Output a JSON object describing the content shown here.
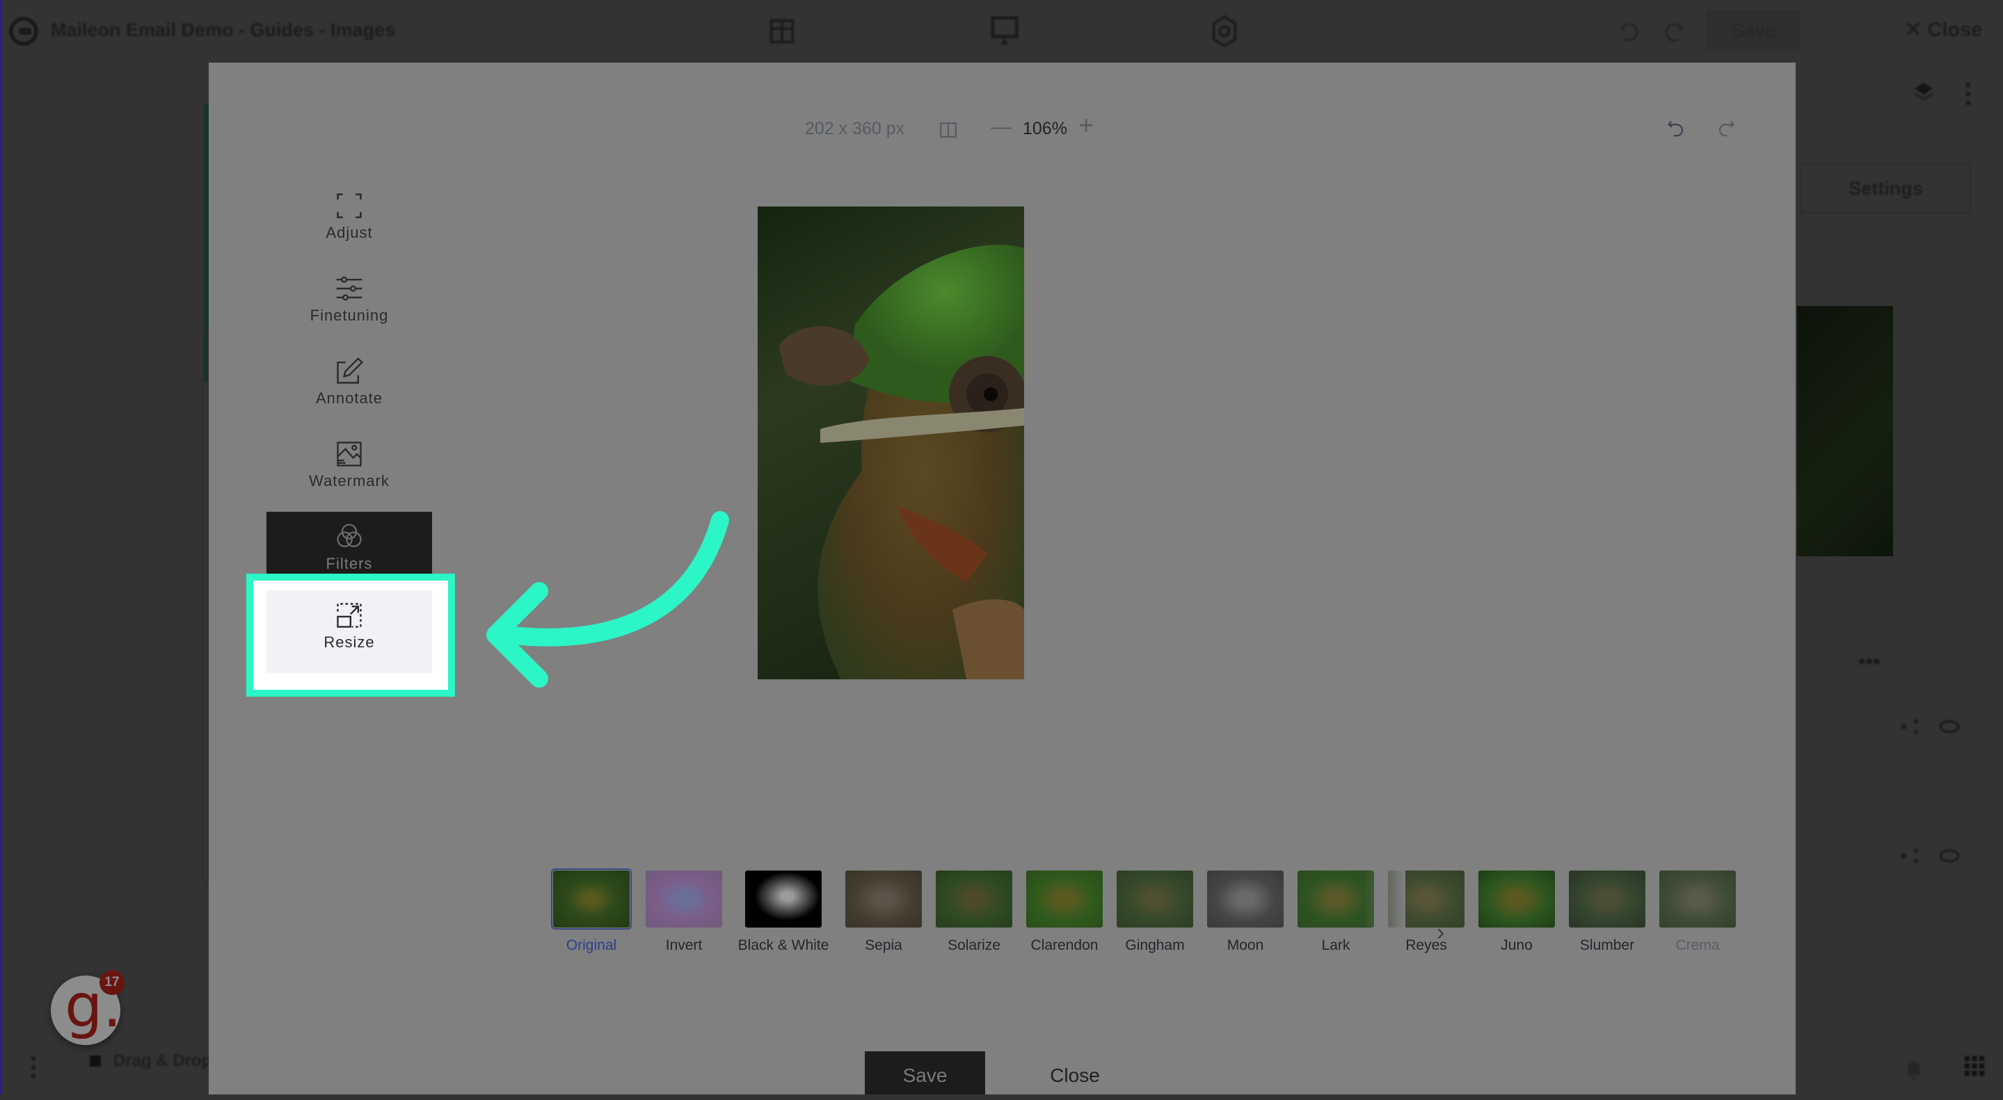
{
  "background_app": {
    "title": "Maileon Email Demo - Guides - Images",
    "save_label": "Save",
    "close_label": "Close",
    "settings_label": "Settings",
    "bottom_item_label": "Drag & Drop",
    "icons": [
      "layout-icon",
      "desktop-preview-icon",
      "settings-gear-icon",
      "undo-icon",
      "redo-icon",
      "layers-icon",
      "more-vert-icon",
      "bell-icon",
      "apps-grid-icon"
    ]
  },
  "gamification_widget": {
    "letter": "g.",
    "badge_count": "17",
    "brand_color": "#6a1410"
  },
  "editor": {
    "image_dimensions": "202 x 360 px",
    "zoom_level": "106%",
    "zoom_out_label": "—",
    "zoom_in_label": "+",
    "side_menu": [
      {
        "id": "adjust",
        "label": "Adjust",
        "icon": "crop-corners-icon",
        "state": "normal"
      },
      {
        "id": "finetuning",
        "label": "Finetuning",
        "icon": "sliders-icon",
        "state": "normal"
      },
      {
        "id": "annotate",
        "label": "Annotate",
        "icon": "pencil-edit-icon",
        "state": "normal"
      },
      {
        "id": "watermark",
        "label": "Watermark",
        "icon": "image-watermark-icon",
        "state": "normal"
      },
      {
        "id": "filters",
        "label": "Filters",
        "icon": "color-circles-icon",
        "state": "active"
      },
      {
        "id": "resize",
        "label": "Resize",
        "icon": "resize-arrow-icon",
        "state": "highlighted"
      }
    ],
    "filters": [
      {
        "label": "Original",
        "selected": true
      },
      {
        "label": "Invert",
        "selected": false
      },
      {
        "label": "Black & White",
        "selected": false
      },
      {
        "label": "Sepia",
        "selected": false
      },
      {
        "label": "Solarize",
        "selected": false
      },
      {
        "label": "Clarendon",
        "selected": false
      },
      {
        "label": "Gingham",
        "selected": false
      },
      {
        "label": "Moon",
        "selected": false
      },
      {
        "label": "Lark",
        "selected": false
      },
      {
        "label": "Reyes",
        "selected": false
      },
      {
        "label": "Juno",
        "selected": false
      },
      {
        "label": "Slumber",
        "selected": false
      },
      {
        "label": "Crema",
        "selected": false
      }
    ],
    "save_label": "Save",
    "close_label": "Close"
  },
  "annotation": {
    "highlight_color": "#2cf5c6",
    "target": "resize"
  }
}
